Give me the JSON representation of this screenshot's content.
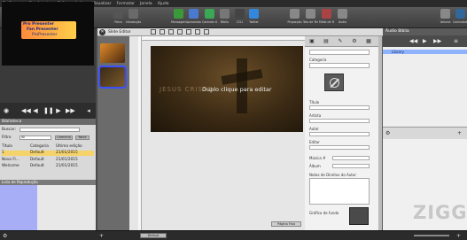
{
  "menubar": [
    "ProPresenter 5",
    "Arquivo",
    "Editar",
    "Ações",
    "Visualizar",
    "Formatar",
    "Janela",
    "Ajuda"
  ],
  "toolbar": [
    {
      "label": "Desconectado",
      "color": "#cc2222",
      "icon": "close-x-icon"
    },
    {
      "label": "Slide",
      "color": "#999999",
      "icon": "slide-icon"
    },
    {
      "label": "Biblioteca",
      "color": "#888888",
      "icon": "library-icon"
    },
    {
      "label": "Logo",
      "color": "#777777",
      "icon": "logo-icon"
    },
    {
      "label": "Palco",
      "color": "#555555",
      "icon": "stage-icon"
    },
    {
      "label": "Introdução de Vídeo",
      "color": "#6a6a6a",
      "icon": "video-icon"
    },
    {
      "label": "Mensagens",
      "color": "#3a9a3a",
      "icon": "messages-icon"
    },
    {
      "label": "Apresentação",
      "color": "#4a7ad0",
      "icon": "presentation-icon"
    },
    {
      "label": "Controle de Música",
      "color": "#3aa855",
      "icon": "music-icon"
    },
    {
      "label": "Bíblia",
      "color": "#777777",
      "icon": "bible-icon"
    },
    {
      "label": "CCLI",
      "color": "#444444",
      "icon": "ccli-icon"
    },
    {
      "label": "Twitter",
      "color": "#3388dd",
      "icon": "twitter-icon"
    },
    {
      "label": "Proporção",
      "color": "#888888",
      "icon": "aspect-icon"
    },
    {
      "label": "Tela de Temporizador",
      "color": "#888888",
      "icon": "timer-icon"
    },
    {
      "label": "Mídia de Tela",
      "color": "#aa4444",
      "icon": "screen-media-icon"
    },
    {
      "label": "Áudio",
      "color": "#888888",
      "icon": "audio-icon"
    },
    {
      "label": "Volume",
      "color": "#888888",
      "icon": "volume-icon"
    },
    {
      "label": "Controlador",
      "color": "#336699",
      "icon": "controller-icon"
    }
  ],
  "preview": {
    "line1": "Pro Presenter",
    "line2": "Fan Presenter",
    "line3": "ProPresenter"
  },
  "library": {
    "title": "Biblioteca",
    "search_label": "Buscar:",
    "filter_label": "Filtro",
    "filter_value": "All",
    "btn_add": "Caminho",
    "btn_new": "Nova",
    "columns": [
      "Título",
      "Categoria",
      "Última edição"
    ],
    "rows": [
      {
        "title": "1",
        "category": "Default",
        "date": "21/01/2015",
        "selected": true
      },
      {
        "title": "Novo Fi...",
        "category": "Default",
        "date": "21/01/2015",
        "selected": false
      },
      {
        "title": "Welcome",
        "category": "Default",
        "date": "21/01/2015",
        "selected": false
      }
    ]
  },
  "playlist": {
    "title": "Lista de Reprodução"
  },
  "editor": {
    "window_title": "Slide Editor",
    "slide_text": "Duplo clique para editar",
    "watermark": "JESUS CRISTO"
  },
  "props": {
    "category_label": "Categoria",
    "fields": [
      "Título",
      "Artista",
      "Autor",
      "Editor",
      "Música #",
      "Álbum",
      "Notas de Direitos do Autor"
    ],
    "footer_label": "Gráfico de fundo"
  },
  "audio": {
    "title": "Áudio Bíblia",
    "selected_item": "Library"
  },
  "bottom": {
    "zoom_label": "Default",
    "page_label": "Página Fixa"
  },
  "watermark": "ZIGG",
  "colors": {
    "selection_blue": "#8fb2ff",
    "playlist_blue": "#a8aef5"
  }
}
